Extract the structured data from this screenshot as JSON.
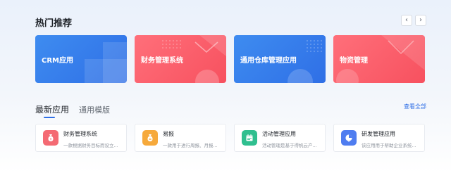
{
  "recommend": {
    "title": "热门推荐",
    "banners": [
      {
        "label": "CRM应用",
        "color": "#3a82ef"
      },
      {
        "label": "财务管理系统",
        "color": "#fa5d69"
      },
      {
        "label": "通用仓库管理应用",
        "color": "#3a82ef"
      },
      {
        "label": "物资管理",
        "color": "#fa5d69"
      }
    ]
  },
  "apps": {
    "tabs": [
      {
        "label": "最新应用",
        "active": true
      },
      {
        "label": "通用模版",
        "active": false
      }
    ],
    "view_all": "查看全部",
    "cards": [
      {
        "name": "财务管理系统",
        "desc": "一款根据财务目标而设立...",
        "icon": "money-bag-icon",
        "icon_color": "#f46a73"
      },
      {
        "name": "易报",
        "desc": "一款用于进行周报、月报...",
        "icon": "report-icon",
        "icon_color": "#f6a93b"
      },
      {
        "name": "活动管理应用",
        "desc": "活动管理是基于得帆云产...",
        "icon": "calendar-icon",
        "icon_color": "#2fbf8f"
      },
      {
        "name": "研发管理应用",
        "desc": "该应用用于帮助企业系统...",
        "icon": "dev-icon",
        "icon_color": "#4f7df0"
      }
    ]
  }
}
